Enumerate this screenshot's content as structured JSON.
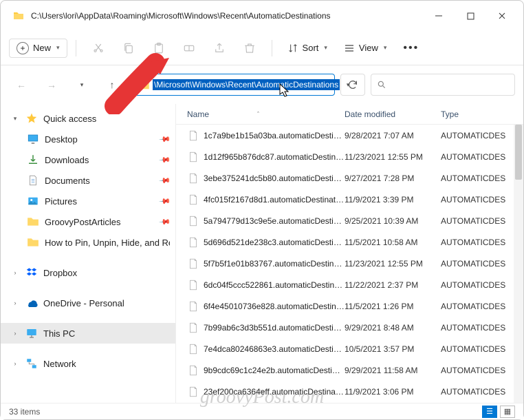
{
  "window": {
    "title": "C:\\Users\\lori\\AppData\\Roaming\\Microsoft\\Windows\\Recent\\AutomaticDestinations"
  },
  "toolbar": {
    "new_label": "New",
    "sort_label": "Sort",
    "view_label": "View"
  },
  "address": {
    "path": "\\Microsoft\\Windows\\Recent\\AutomaticDestinations"
  },
  "search": {
    "placeholder": ""
  },
  "sidebar": {
    "quick_access": "Quick access",
    "desktop": "Desktop",
    "downloads": "Downloads",
    "documents": "Documents",
    "pictures": "Pictures",
    "groovy": "GroovyPostArticles",
    "howto": "How to Pin, Unpin, Hide, and Re",
    "dropbox": "Dropbox",
    "onedrive": "OneDrive - Personal",
    "thispc": "This PC",
    "network": "Network"
  },
  "columns": {
    "name": "Name",
    "date": "Date modified",
    "type": "Type"
  },
  "files": [
    {
      "name": "1c7a9be1b15a03ba.automaticDestination..",
      "date": "9/28/2021 7:07 AM",
      "type": "AUTOMATICDES"
    },
    {
      "name": "1d12f965b876dc87.automaticDestination..",
      "date": "11/23/2021 12:55 PM",
      "type": "AUTOMATICDES"
    },
    {
      "name": "3ebe375241dc5b80.automaticDestination..",
      "date": "9/27/2021 7:28 PM",
      "type": "AUTOMATICDES"
    },
    {
      "name": "4fc015f2167d8d1.automaticDestinations-..",
      "date": "11/9/2021 3:39 PM",
      "type": "AUTOMATICDES"
    },
    {
      "name": "5a794779d13c9e5e.automaticDestination..",
      "date": "9/25/2021 10:39 AM",
      "type": "AUTOMATICDES"
    },
    {
      "name": "5d696d521de238c3.automaticDestination..",
      "date": "11/5/2021 10:58 AM",
      "type": "AUTOMATICDES"
    },
    {
      "name": "5f7b5f1e01b83767.automaticDestination..",
      "date": "11/23/2021 12:55 PM",
      "type": "AUTOMATICDES"
    },
    {
      "name": "6dc04f5ccc522861.automaticDestination..",
      "date": "11/22/2021 2:37 PM",
      "type": "AUTOMATICDES"
    },
    {
      "name": "6f4e45010736e828.automaticDestination..",
      "date": "11/5/2021 1:26 PM",
      "type": "AUTOMATICDES"
    },
    {
      "name": "7b99ab6c3d3b551d.automaticDestination..",
      "date": "9/29/2021 8:48 AM",
      "type": "AUTOMATICDES"
    },
    {
      "name": "7e4dca80246863e3.automaticDestination..",
      "date": "10/5/2021 3:57 PM",
      "type": "AUTOMATICDES"
    },
    {
      "name": "9b9cdc69c1c24e2b.automaticDestination..",
      "date": "9/29/2021 11:58 AM",
      "type": "AUTOMATICDES"
    },
    {
      "name": "23ef200ca6364eff.automaticDestinations-..",
      "date": "11/9/2021 3:06 PM",
      "type": "AUTOMATICDES"
    }
  ],
  "status": {
    "count": "33 items"
  },
  "watermark": "groovyPost.com"
}
